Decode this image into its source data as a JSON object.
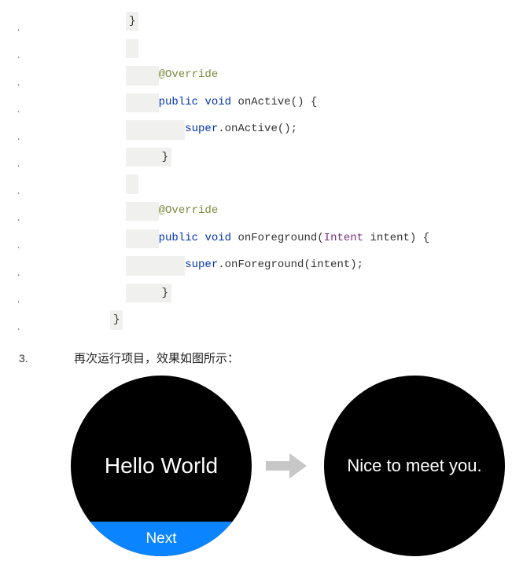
{
  "code": {
    "lines": [
      {
        "indent": 140,
        "tokens": [
          {
            "t": "}",
            "c": "punct",
            "bg": true
          }
        ]
      },
      {
        "indent": 140,
        "tokens": [
          {
            "t": " ",
            "c": "punct",
            "bg": true
          }
        ]
      },
      {
        "indent": 140,
        "tokens": [
          {
            "t": "    ",
            "c": "",
            "bg": true
          },
          {
            "t": "@Override",
            "c": "annotation"
          }
        ]
      },
      {
        "indent": 140,
        "tokens": [
          {
            "t": "    ",
            "c": "",
            "bg": true
          },
          {
            "t": "public",
            "c": "keyword"
          },
          {
            "t": " ",
            "c": ""
          },
          {
            "t": "void",
            "c": "keyword"
          },
          {
            "t": " ",
            "c": ""
          },
          {
            "t": "onActive",
            "c": "method"
          },
          {
            "t": "() {",
            "c": "punct"
          }
        ]
      },
      {
        "indent": 140,
        "tokens": [
          {
            "t": "        ",
            "c": "",
            "bg": true
          },
          {
            "t": "super",
            "c": "keyword"
          },
          {
            "t": ".onActive();",
            "c": "punct"
          }
        ]
      },
      {
        "indent": 140,
        "tokens": [
          {
            "t": "    ",
            "c": "",
            "bg": true
          },
          {
            "t": "}",
            "c": "punct",
            "bg": true
          }
        ]
      },
      {
        "indent": 140,
        "tokens": [
          {
            "t": " ",
            "c": "punct",
            "bg": true
          }
        ]
      },
      {
        "indent": 140,
        "tokens": [
          {
            "t": "    ",
            "c": "",
            "bg": true
          },
          {
            "t": "@Override",
            "c": "annotation"
          }
        ]
      },
      {
        "indent": 140,
        "tokens": [
          {
            "t": "    ",
            "c": "",
            "bg": true
          },
          {
            "t": "public",
            "c": "keyword"
          },
          {
            "t": " ",
            "c": ""
          },
          {
            "t": "void",
            "c": "keyword"
          },
          {
            "t": " ",
            "c": ""
          },
          {
            "t": "onForeground",
            "c": "method"
          },
          {
            "t": "(",
            "c": "punct"
          },
          {
            "t": "Intent",
            "c": "class"
          },
          {
            "t": " intent) {",
            "c": "punct"
          }
        ]
      },
      {
        "indent": 140,
        "tokens": [
          {
            "t": "        ",
            "c": "",
            "bg": true
          },
          {
            "t": "super",
            "c": "keyword"
          },
          {
            "t": ".onForeground(intent);",
            "c": "punct"
          }
        ]
      },
      {
        "indent": 140,
        "tokens": [
          {
            "t": "    ",
            "c": "",
            "bg": true
          },
          {
            "t": "}",
            "c": "punct",
            "bg": true
          }
        ]
      },
      {
        "indent": 120,
        "tokens": [
          {
            "t": "}",
            "c": "punct",
            "bg": true
          }
        ]
      }
    ]
  },
  "step": {
    "number": "3.",
    "text": "再次运行项目，效果如图所示："
  },
  "figure": {
    "left": {
      "main_text": "Hello World",
      "button_text": "Next"
    },
    "right": {
      "main_text": "Nice to meet you."
    }
  }
}
